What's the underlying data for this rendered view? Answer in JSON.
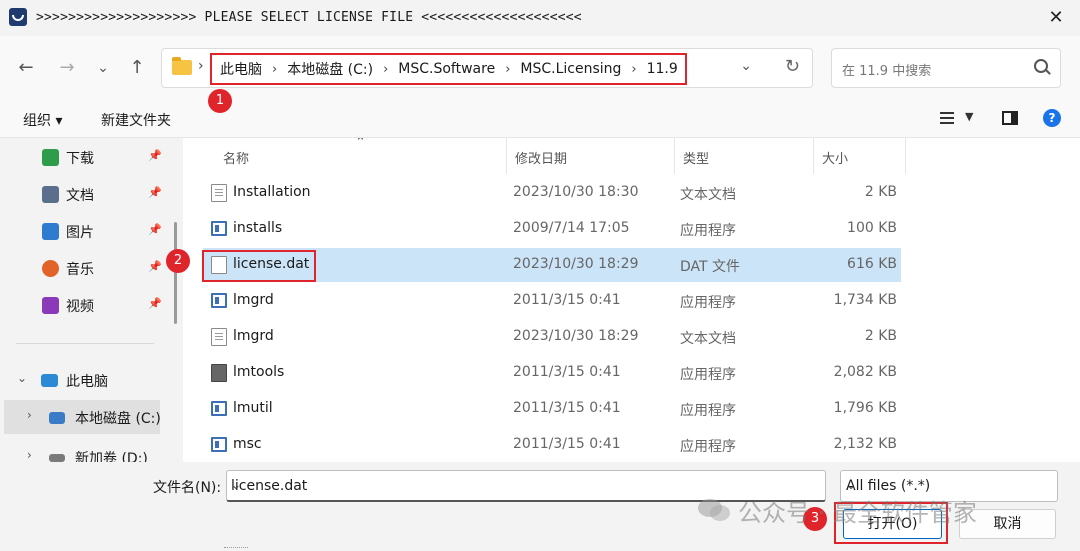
{
  "window": {
    "title": ">>>>>>>>>>>>>>>>>>>>  PLEASE SELECT LICENSE FILE  <<<<<<<<<<<<<<<<<<<<",
    "close_glyph": "✕"
  },
  "nav": {
    "back_glyph": "←",
    "forward_glyph": "→",
    "recent_glyph": "⌄",
    "up_glyph": "↑",
    "address_chevron": "›",
    "breadcrumbs": [
      "此电脑",
      "本地磁盘 (C:)",
      "MSC.Software",
      "MSC.Licensing",
      "11.9"
    ],
    "breadcrumb_sep": "›",
    "dropdown_glyph": "⌄",
    "refresh_glyph": "↻",
    "search_placeholder": "在 11.9 中搜索"
  },
  "toolbar": {
    "organize": "组织 ▾",
    "new_folder": "新建文件夹",
    "view_dropdown": "▼",
    "help": "?"
  },
  "sidebar": {
    "pin_glyph": "📌",
    "items": [
      {
        "label": "下载",
        "icon": "download-icon",
        "color": "#2e9c4a",
        "pinned": true
      },
      {
        "label": "文档",
        "icon": "document-icon",
        "color": "#5b6f8c",
        "pinned": true
      },
      {
        "label": "图片",
        "icon": "picture-icon",
        "color": "#2f7bd0",
        "pinned": true
      },
      {
        "label": "音乐",
        "icon": "music-icon",
        "color": "#e2632a",
        "pinned": true
      },
      {
        "label": "视频",
        "icon": "video-icon",
        "color": "#8a3ab9",
        "pinned": true
      }
    ],
    "this_pc": {
      "label": "此电脑",
      "chevron": "⌄"
    },
    "local_disk": {
      "label": "本地磁盘 (C:)",
      "chevron": "›"
    },
    "new_volume": {
      "label": "新加卷 (D:)",
      "chevron": "›"
    }
  },
  "filelist": {
    "columns": [
      "名称",
      "修改日期",
      "类型",
      "大小"
    ],
    "sort_caret": "⌃",
    "rows": [
      {
        "name": "Installation",
        "date": "2023/10/30 18:30",
        "type": "文本文档",
        "size": "2 KB",
        "icon": "doc"
      },
      {
        "name": "installs",
        "date": "2009/7/14 17:05",
        "type": "应用程序",
        "size": "100 KB",
        "icon": "exe"
      },
      {
        "name": "license.dat",
        "date": "2023/10/30 18:29",
        "type": "DAT 文件",
        "size": "616 KB",
        "icon": "blank",
        "selected": true
      },
      {
        "name": "lmgrd",
        "date": "2011/3/15 0:41",
        "type": "应用程序",
        "size": "1,734 KB",
        "icon": "exe"
      },
      {
        "name": "lmgrd",
        "date": "2023/10/30 18:29",
        "type": "文本文档",
        "size": "2 KB",
        "icon": "doc"
      },
      {
        "name": "lmtools",
        "date": "2011/3/15 0:41",
        "type": "应用程序",
        "size": "2,082 KB",
        "icon": "tool"
      },
      {
        "name": "lmutil",
        "date": "2011/3/15 0:41",
        "type": "应用程序",
        "size": "1,796 KB",
        "icon": "exe"
      },
      {
        "name": "msc",
        "date": "2011/3/15 0:41",
        "type": "应用程序",
        "size": "2,132 KB",
        "icon": "exe"
      }
    ]
  },
  "bottom": {
    "filename_label": "文件名(N):",
    "filename_value": "license.dat",
    "filter_value": "All files (*.*)",
    "dropdown_glyph": "⌄",
    "open_label": "打开(O)",
    "cancel_label": "取消"
  },
  "badges": [
    "1",
    "2",
    "3"
  ],
  "watermark": "公众号 · 最全软件管家",
  "colors": {
    "annotation": "#e0242b",
    "selection": "#cce4f7",
    "accent": "#0067c0"
  }
}
